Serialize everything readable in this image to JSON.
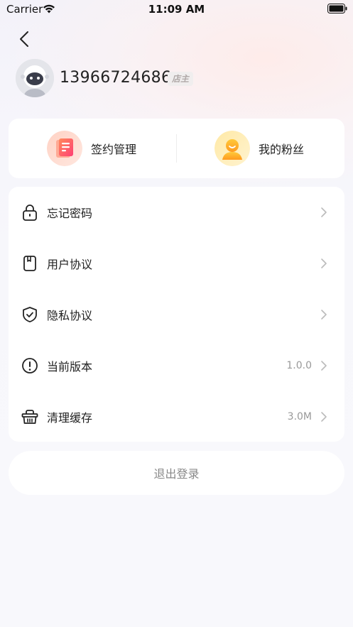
{
  "status_bar": {
    "carrier": "Carrier",
    "time": "11:09 AM"
  },
  "profile": {
    "phone": "13966724686",
    "role": "店主"
  },
  "quick_actions": [
    {
      "label": "签约管理",
      "icon": "contract-icon"
    },
    {
      "label": "我的粉丝",
      "icon": "fans-icon"
    }
  ],
  "settings": [
    {
      "label": "忘记密码",
      "icon": "lock-icon",
      "value": ""
    },
    {
      "label": "用户协议",
      "icon": "document-icon",
      "value": ""
    },
    {
      "label": "隐私协议",
      "icon": "shield-check-icon",
      "value": ""
    },
    {
      "label": "当前版本",
      "icon": "info-circle-icon",
      "value": "1.0.0"
    },
    {
      "label": "清理缓存",
      "icon": "basket-icon",
      "value": "3.0M"
    }
  ],
  "logout_label": "退出登录",
  "colors": {
    "contract_gradient": [
      "#ff8a5c",
      "#ff4f7a"
    ],
    "fans_gradient": [
      "#ffcf3f",
      "#ff9a1f"
    ],
    "background": "#f8f8fc"
  }
}
